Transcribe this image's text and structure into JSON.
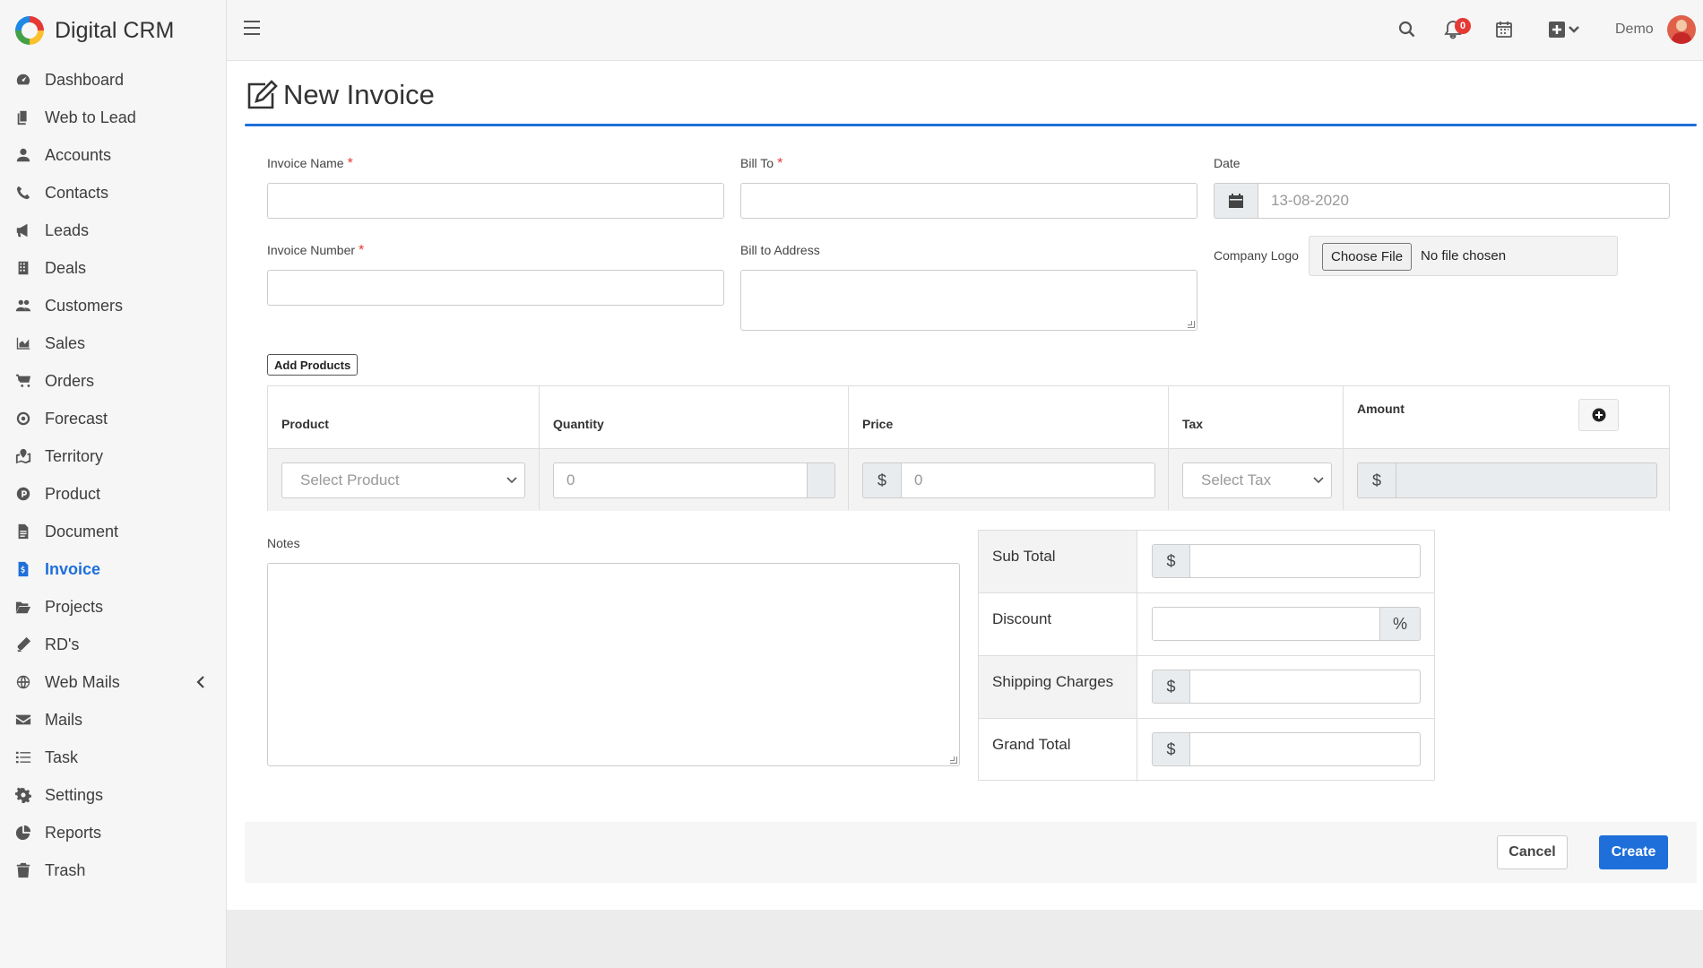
{
  "app": {
    "brand": "Digital CRM"
  },
  "sidebar": {
    "items": [
      {
        "label": "Dashboard",
        "icon": "dashboard-icon"
      },
      {
        "label": "Web to Lead",
        "icon": "copy-icon"
      },
      {
        "label": "Accounts",
        "icon": "user-icon"
      },
      {
        "label": "Contacts",
        "icon": "phone-icon"
      },
      {
        "label": "Leads",
        "icon": "bullhorn-icon"
      },
      {
        "label": "Deals",
        "icon": "building-icon"
      },
      {
        "label": "Customers",
        "icon": "users-icon"
      },
      {
        "label": "Sales",
        "icon": "area-chart-icon"
      },
      {
        "label": "Orders",
        "icon": "cart-icon"
      },
      {
        "label": "Forecast",
        "icon": "bullseye-icon"
      },
      {
        "label": "Territory",
        "icon": "map-marked-icon"
      },
      {
        "label": "Product",
        "icon": "product-p-icon"
      },
      {
        "label": "Document",
        "icon": "file-icon"
      },
      {
        "label": "Invoice",
        "icon": "invoice-icon",
        "active": true
      },
      {
        "label": "Projects",
        "icon": "folder-open-icon"
      },
      {
        "label": "RD's",
        "icon": "pencil-icon"
      },
      {
        "label": "Web Mails",
        "icon": "globe-icon"
      },
      {
        "label": "Mails",
        "icon": "envelope-icon"
      },
      {
        "label": "Task",
        "icon": "tasks-icon"
      },
      {
        "label": "Settings",
        "icon": "gear-icon"
      },
      {
        "label": "Reports",
        "icon": "pie-chart-icon"
      },
      {
        "label": "Trash",
        "icon": "trash-icon"
      }
    ]
  },
  "topbar": {
    "notifications_count": "0",
    "user_name": "Demo"
  },
  "page": {
    "title": "New Invoice"
  },
  "form": {
    "invoice_name_label": "Invoice Name",
    "bill_to_label": "Bill To",
    "date_label": "Date",
    "date_placeholder": "13-08-2020",
    "invoice_number_label": "Invoice Number",
    "bill_to_address_label": "Bill to Address",
    "company_logo_label": "Company Logo",
    "choose_file_label": "Choose File",
    "file_status": "No file chosen",
    "required_mark": "*",
    "add_products_label": "Add Products",
    "notes_label": "Notes"
  },
  "products": {
    "headers": [
      "Product",
      "Quantity",
      "Price",
      "Tax",
      "Amount"
    ],
    "row": {
      "product_placeholder": "Select Product",
      "quantity_placeholder": "0",
      "price_prefix": "$",
      "price_placeholder": "0",
      "tax_placeholder": "Select Tax",
      "amount_prefix": "$"
    }
  },
  "totals": {
    "sub_total_label": "Sub Total",
    "discount_label": "Discount",
    "shipping_label": "Shipping Charges",
    "grand_total_label": "Grand Total",
    "currency_symbol": "$",
    "percent_symbol": "%"
  },
  "actions": {
    "cancel_label": "Cancel",
    "create_label": "Create"
  },
  "colors": {
    "accent": "#1e6fd9",
    "danger": "#e53935"
  }
}
